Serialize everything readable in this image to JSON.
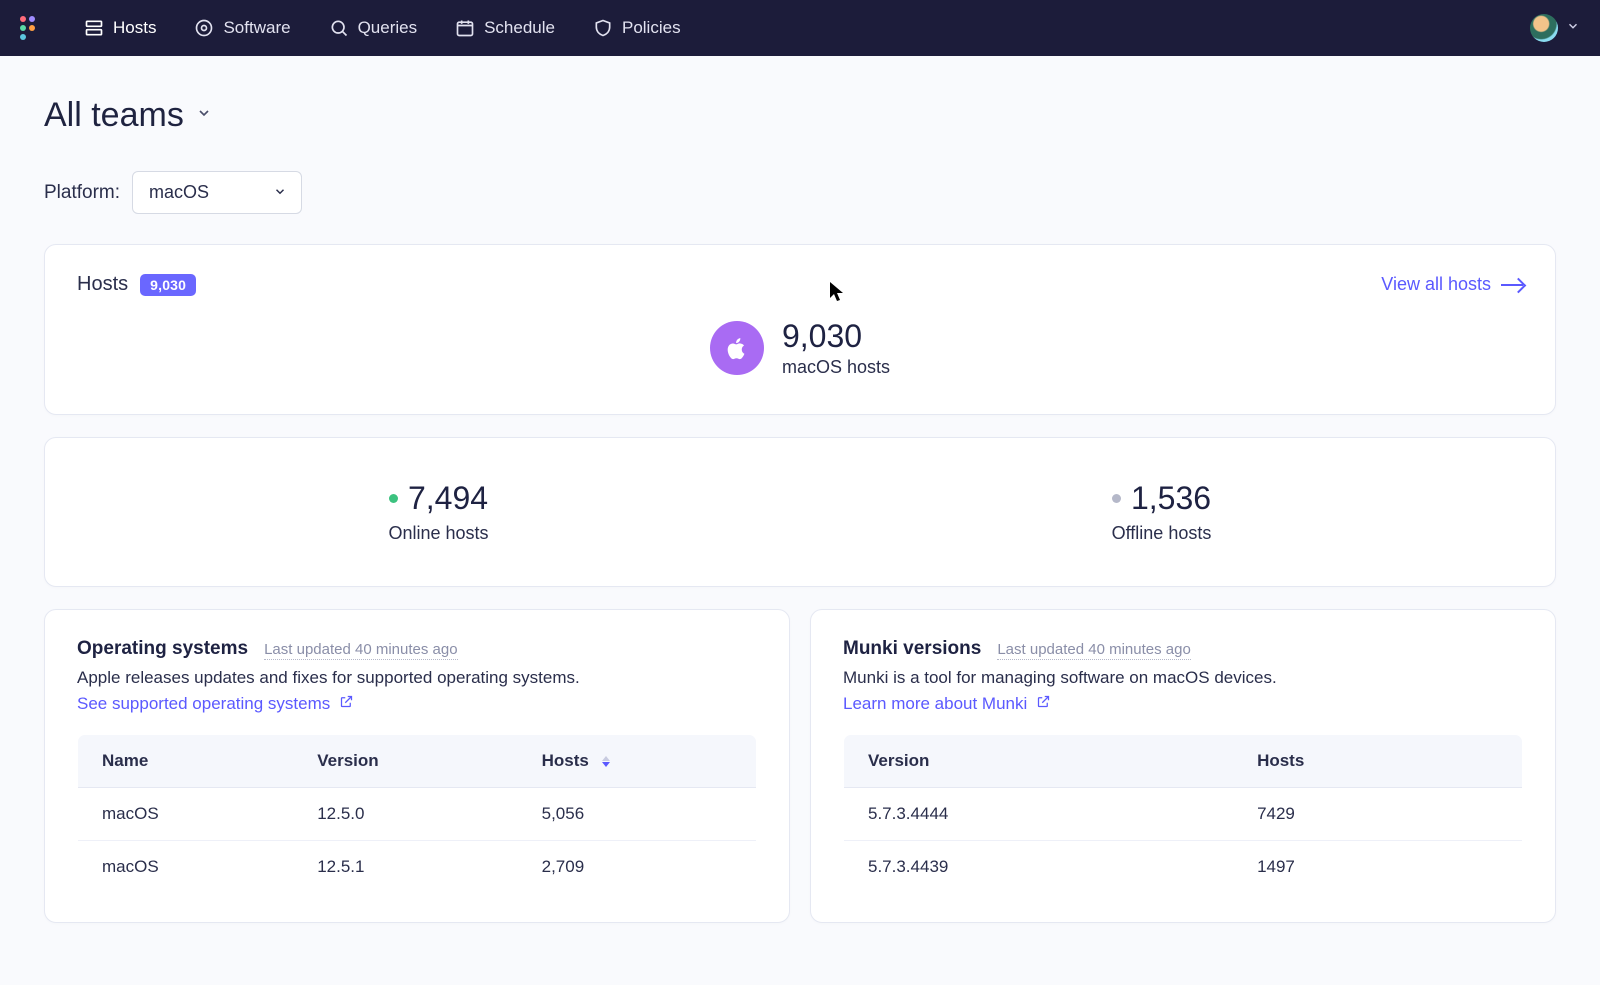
{
  "nav": {
    "items": [
      {
        "label": "Hosts"
      },
      {
        "label": "Software"
      },
      {
        "label": "Queries"
      },
      {
        "label": "Schedule"
      },
      {
        "label": "Policies"
      }
    ]
  },
  "team_selector": {
    "label": "All teams"
  },
  "platform": {
    "label_text": "Platform:",
    "selected": "macOS"
  },
  "hosts_card": {
    "title": "Hosts",
    "badge": "9,030",
    "view_all": "View all hosts",
    "big_count": "9,030",
    "big_sub": "macOS hosts"
  },
  "status": {
    "online": {
      "count": "7,494",
      "label": "Online hosts"
    },
    "offline": {
      "count": "1,536",
      "label": "Offline hosts"
    }
  },
  "os_panel": {
    "title": "Operating systems",
    "updated": "Last updated 40 minutes ago",
    "desc": "Apple releases updates and fixes for supported operating systems.",
    "link": "See supported operating systems",
    "columns": {
      "name": "Name",
      "version": "Version",
      "hosts": "Hosts"
    },
    "rows": [
      {
        "name": "macOS",
        "version": "12.5.0",
        "hosts": "5,056"
      },
      {
        "name": "macOS",
        "version": "12.5.1",
        "hosts": "2,709"
      }
    ]
  },
  "munki_panel": {
    "title": "Munki versions",
    "updated": "Last updated 40 minutes ago",
    "desc": "Munki is a tool for managing software on macOS devices.",
    "link": "Learn more about Munki",
    "columns": {
      "version": "Version",
      "hosts": "Hosts"
    },
    "rows": [
      {
        "version": "5.7.3.4444",
        "hosts": "7429"
      },
      {
        "version": "5.7.3.4439",
        "hosts": "1497"
      }
    ]
  }
}
